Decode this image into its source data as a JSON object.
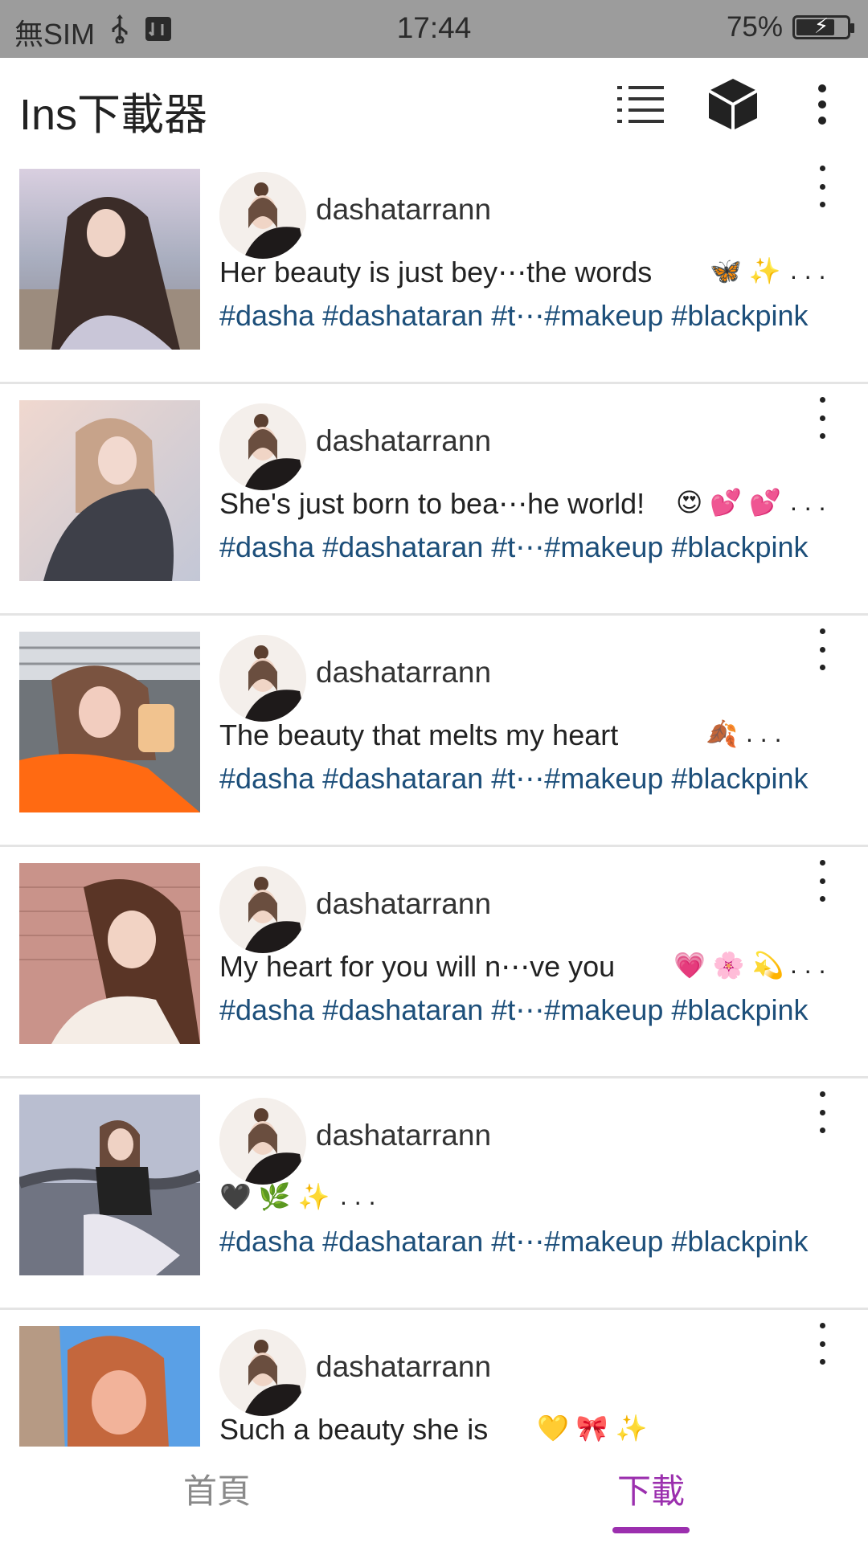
{
  "status_bar": {
    "carrier": "無SIM",
    "time": "17:44",
    "battery_percent": "75%",
    "battery_level": 0.75
  },
  "app_bar": {
    "title": "Ins下載器",
    "icons": [
      "list-view-icon",
      "cube-icon",
      "more-vert-icon"
    ]
  },
  "posts": [
    {
      "username": "dashatarrann",
      "caption": "Her beauty is just bey⋯the words",
      "emoji": "🦋 ✨",
      "ellipsis": ". . .",
      "tags": "#dasha #dashataran #t⋯#makeup #blackpink"
    },
    {
      "username": "dashatarrann",
      "caption": "She's just born to bea⋯he world!",
      "emoji": "😍 💕 💕",
      "ellipsis": ". . .",
      "tags": "#dasha #dashataran #t⋯#makeup #blackpink"
    },
    {
      "username": "dashatarrann",
      "caption": "The beauty that melts my heart",
      "emoji": "🍂",
      "ellipsis": ". . .",
      "tags": "#dasha #dashataran #t⋯#makeup #blackpink"
    },
    {
      "username": "dashatarrann",
      "caption": "My heart for you will n⋯ve you",
      "emoji": "💗 🌸 💫",
      "ellipsis": ". . .",
      "tags": "#dasha #dashataran #t⋯#makeup #blackpink"
    },
    {
      "username": "dashatarrann",
      "caption": "",
      "emoji": "🖤 🌿 ✨",
      "ellipsis": ". . .",
      "tags": "#dasha #dashataran #t⋯#makeup #blackpink"
    },
    {
      "username": "dashatarrann",
      "caption": "Such a beauty she is",
      "emoji": "💛 🎀 ✨",
      "ellipsis": "",
      "tags": ""
    }
  ],
  "bottom_nav": {
    "home_label": "首頁",
    "downloads_label": "下載",
    "active": "downloads",
    "accent_color": "#9b2fae"
  }
}
